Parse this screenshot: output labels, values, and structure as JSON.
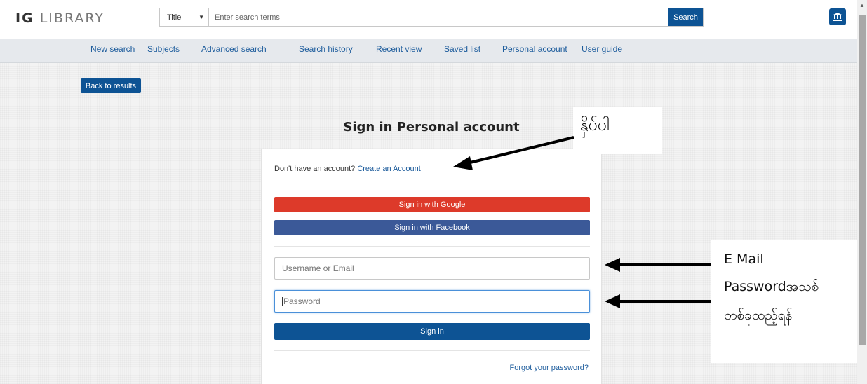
{
  "logo": {
    "part1": "IG",
    "part2": "LIBRARY"
  },
  "search": {
    "field": "Title",
    "placeholder": "Enter search terms",
    "button": "Search"
  },
  "icons": {
    "institution": "institution-icon",
    "dropdown": "caret-down-icon"
  },
  "nav": {
    "items": [
      {
        "label": "New search"
      },
      {
        "label": "Subjects"
      },
      {
        "label": "Advanced search"
      },
      {
        "label": "Search history"
      },
      {
        "label": "Recent view"
      },
      {
        "label": "Saved list"
      },
      {
        "label": "Personal account"
      },
      {
        "label": "User guide"
      }
    ]
  },
  "page": {
    "back_label": "Back to results",
    "title": "Sign in Personal account"
  },
  "signin": {
    "no_account_text": "Don't have an account?",
    "create_account": "Create an Account",
    "google_label": "Sign in with Google",
    "facebook_label": "Sign in with Facebook",
    "username_placeholder": "Username or Email",
    "password_placeholder": "Password",
    "signin_label": "Sign in",
    "forgot_label": "Forgot your password?"
  },
  "annotations": {
    "create_account_note": "နှိပ်ပါ",
    "email_note": "E Mail",
    "password_note_line1": "Passwordအသစ်",
    "password_note_line2": "တစ်ခုထည့်ရန်"
  },
  "colors": {
    "primary": "#0d5394",
    "google": "#dd3a2a",
    "facebook": "#3b5998",
    "link": "#1d5c9c"
  }
}
